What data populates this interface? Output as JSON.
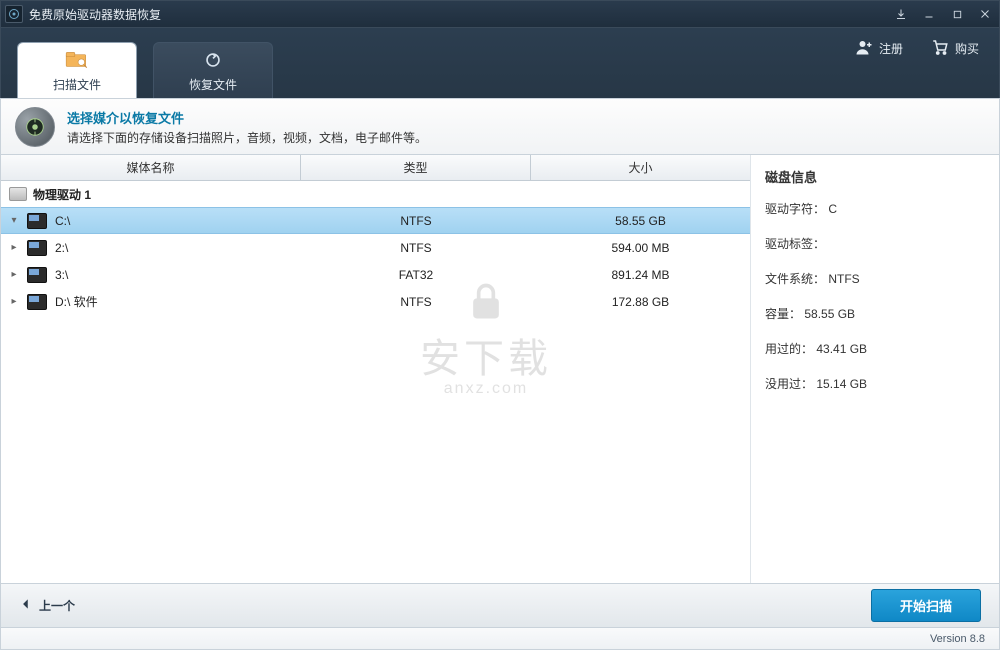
{
  "window": {
    "title": "免费原始驱动器数据恢复"
  },
  "header": {
    "tab_scan": "扫描文件",
    "tab_recover": "恢复文件",
    "register": "注册",
    "buy": "购买"
  },
  "info": {
    "title": "选择媒介以恢复文件",
    "subtitle": "请选择下面的存储设备扫描照片，音频，视频，文档，电子邮件等。"
  },
  "columns": {
    "name": "媒体名称",
    "type": "类型",
    "size": "大小"
  },
  "group_label": "物理驱动 1",
  "rows": [
    {
      "name": "C:\\",
      "type": "NTFS",
      "size": "58.55 GB",
      "selected": true
    },
    {
      "name": "2:\\",
      "type": "NTFS",
      "size": "594.00 MB",
      "selected": false
    },
    {
      "name": "3:\\",
      "type": "FAT32",
      "size": "891.24 MB",
      "selected": false
    },
    {
      "name": "D:\\ 软件",
      "type": "NTFS",
      "size": "172.88 GB",
      "selected": false
    }
  ],
  "disk_info": {
    "title": "磁盘信息",
    "drive_letter_label": "驱动字符：",
    "drive_letter": "C",
    "drive_tag_label": "驱动标签：",
    "drive_tag": "",
    "fs_label": "文件系统：",
    "fs": "NTFS",
    "capacity_label": "容量：",
    "capacity": "58.55 GB",
    "used_label": "用过的：",
    "used": "43.41 GB",
    "free_label": "没用过：",
    "free": "15.14 GB"
  },
  "footer": {
    "back": "上一个",
    "start": "开始扫描",
    "version": "Version 8.8"
  },
  "watermark": {
    "cn": "安下载",
    "en": "anxz.com"
  }
}
